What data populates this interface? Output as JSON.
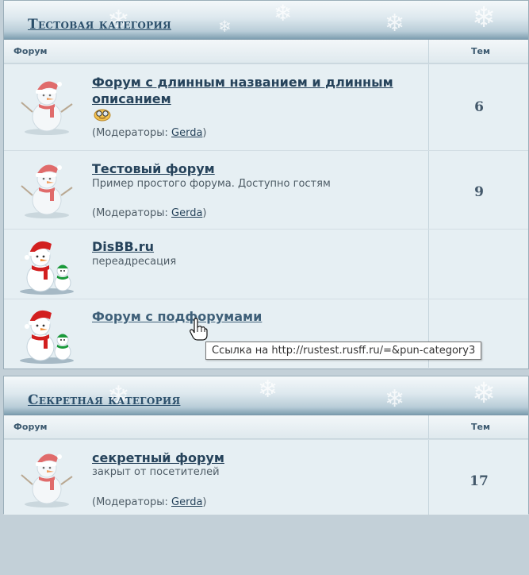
{
  "categories": [
    {
      "title": "Тестовая категория",
      "col_forum": "Форум",
      "col_topics": "Тем",
      "forums": [
        {
          "title": "Форум с длинным названием и длинным описанием",
          "description": "",
          "moderators_prefix": "(Модераторы: ",
          "moderator": "Gerda",
          "moderators_suffix": ")",
          "topics": "6",
          "icon": "snowman-faded-icon",
          "emoticon": "smiley-glasses-icon"
        },
        {
          "title": "Тестовый форум",
          "description": "Пример простого форума. Доступно гостям",
          "moderators_prefix": "(Модераторы: ",
          "moderator": "Gerda",
          "moderators_suffix": ")",
          "topics": "9",
          "icon": "snowman-faded-icon"
        },
        {
          "title": "DisBB.ru",
          "description": "переадресация",
          "topics": "",
          "icon": "snowman-family-icon"
        },
        {
          "title": "Форум с подфорумами",
          "description": "",
          "topics": "",
          "icon": "snowman-family-icon"
        }
      ]
    },
    {
      "title": "Секретная категория",
      "col_forum": "Форум",
      "col_topics": "Тем",
      "forums": [
        {
          "title": "секретный форум",
          "description": "закрыт от посетителей",
          "moderators_prefix": "(Модераторы: ",
          "moderator": "Gerda",
          "moderators_suffix": ")",
          "topics": "17",
          "icon": "snowman-faded-icon"
        }
      ]
    }
  ],
  "tooltip": "Ссылка на http://rustest.rusff.ru/=&pun-category3",
  "cursor_icon": "hand-pointer-icon",
  "colors": {
    "link": "#26435b",
    "text": "#4e5c66",
    "background": "#c3d0d8",
    "panel": "#e6eff3"
  }
}
